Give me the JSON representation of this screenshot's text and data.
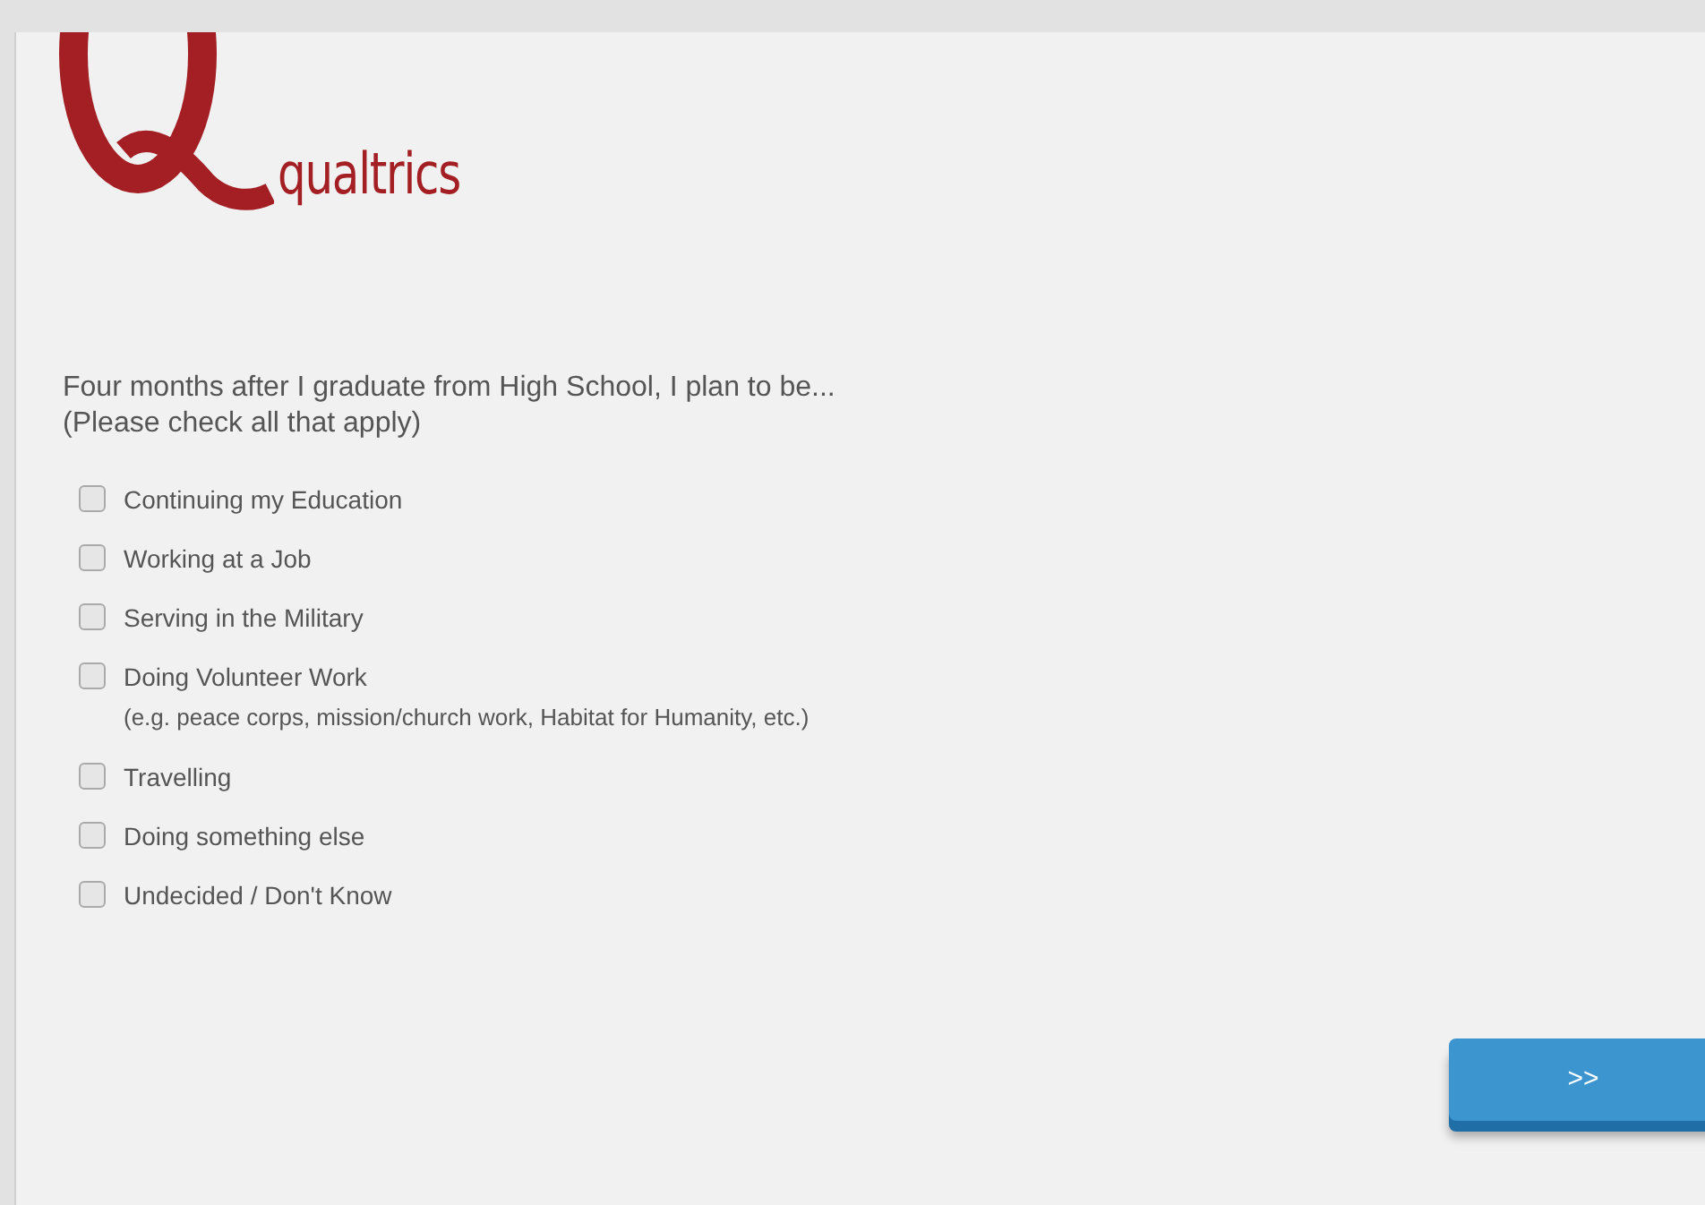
{
  "logo": {
    "wordmark": "qualtrics"
  },
  "question": {
    "text": "Four months after I graduate from High School, I plan to be...",
    "instruction": "(Please check all that apply)"
  },
  "options": [
    {
      "label": "Continuing my Education",
      "checked": false
    },
    {
      "label": "Working at a Job",
      "checked": false
    },
    {
      "label": "Serving in the Military",
      "checked": false
    },
    {
      "label": "Doing Volunteer Work",
      "note": "(e.g. peace corps, mission/church work, Habitat for Humanity, etc.)",
      "checked": false
    },
    {
      "label": "Travelling",
      "checked": false
    },
    {
      "label": "Doing something else",
      "checked": false
    },
    {
      "label": "Undecided / Don't Know",
      "checked": false
    }
  ],
  "next_button": {
    "label": ">>"
  }
}
